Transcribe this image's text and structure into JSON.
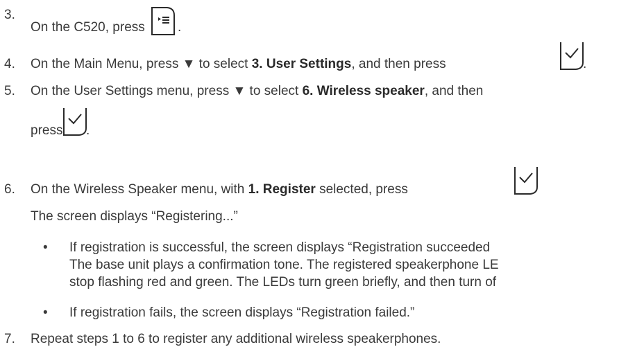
{
  "steps": [
    {
      "num": "3.",
      "text_before": "On the C520, press",
      "text_after": ".",
      "icon": "menu-key-icon"
    },
    {
      "num": "4.",
      "text_before": "On the Main Menu, press ▼ to select ",
      "bold": "3. User Settings",
      "text_mid": ", and then press",
      "text_after": ".",
      "icon": "ok-key-icon"
    },
    {
      "num": "5.",
      "text_before": "On the User Settings menu, press ▼ to select ",
      "bold": "6. Wireless speaker",
      "text_mid": ", and then",
      "line2_before": "press",
      "text_after": ".",
      "icon": "ok-key-icon"
    },
    {
      "num": "6.",
      "text_before": "On the Wireless Speaker menu, with ",
      "bold": "1. Register",
      "text_mid": " selected, press",
      "icon": "ok-key-icon",
      "line2": "The screen displays “Registering...”"
    },
    {
      "num": "7.",
      "text_before": "Repeat steps 1 to 6 to register any additional wireless speakerphones."
    }
  ],
  "bullets": [
    {
      "symbol": "•",
      "lines": [
        "If registration is successful, the screen displays “Registration succeeded",
        "The base unit plays a confirmation tone. The registered speakerphone LE",
        "stop flashing red and green. The LEDs turn green briefly, and then turn of"
      ]
    },
    {
      "symbol": "•",
      "lines": [
        "If registration fails, the screen displays “Registration failed.”"
      ]
    }
  ]
}
